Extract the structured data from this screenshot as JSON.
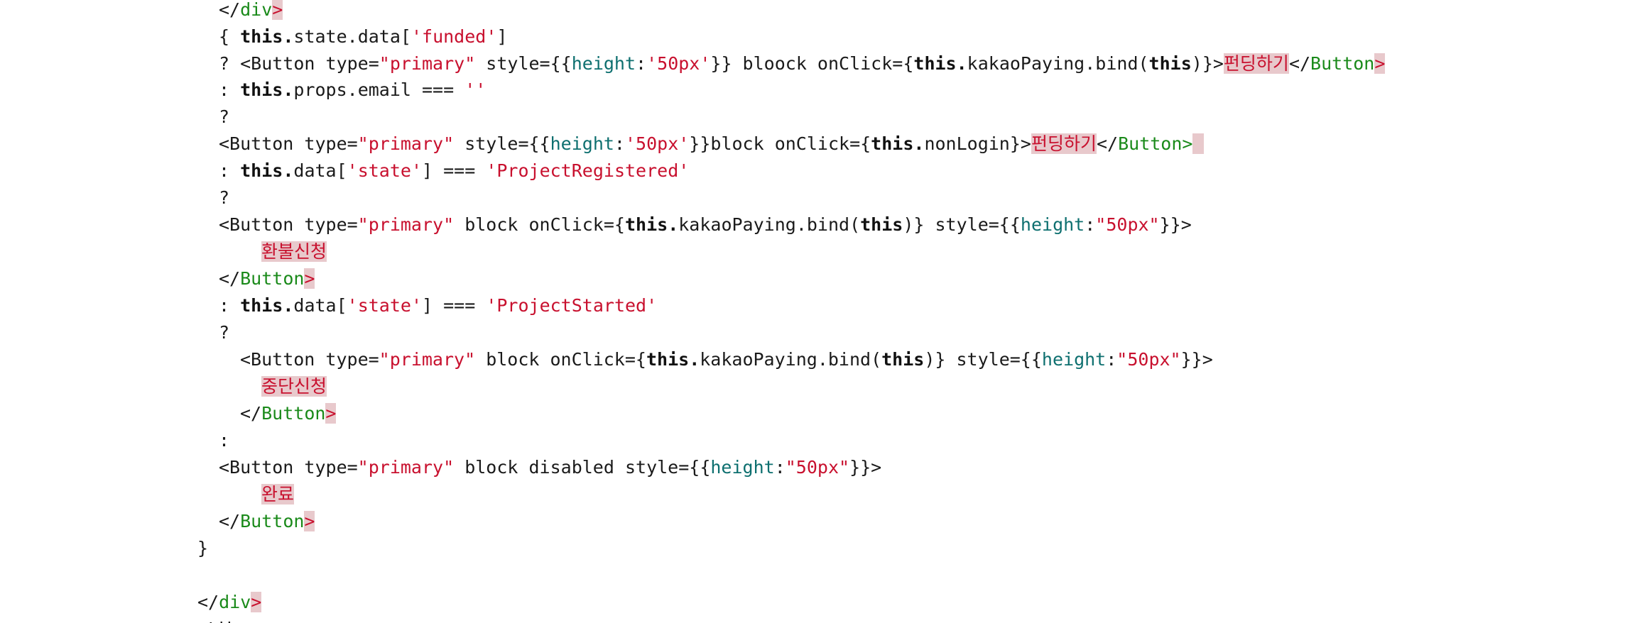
{
  "code_lines": [
    {
      "tokens": [
        [
          "</",
          "punct"
        ],
        [
          "div",
          "tag"
        ],
        [
          ">",
          "gt"
        ]
      ]
    },
    {
      "tokens": [
        [
          "{ ",
          "punct"
        ],
        [
          "this",
          "kw"
        ],
        [
          ".",
          "kw"
        ],
        [
          "state.data[",
          "ident"
        ],
        [
          "'funded'",
          "str"
        ],
        [
          "]",
          "punct"
        ]
      ]
    },
    {
      "tokens": [
        [
          "? <Button type=",
          "ident"
        ],
        [
          "\"primary\"",
          "str"
        ],
        [
          " style={{",
          "ident"
        ],
        [
          "height",
          "prop"
        ],
        [
          ":",
          "punct"
        ],
        [
          "'50px'",
          "str"
        ],
        [
          "}} bloock onClick={",
          "ident"
        ],
        [
          "this",
          "kw"
        ],
        [
          ".",
          "kw"
        ],
        [
          "kakaoPaying.bind(",
          "ident"
        ],
        [
          "this",
          "kw"
        ],
        [
          ")}>",
          "ident"
        ],
        [
          "펀딩하기",
          "text"
        ],
        [
          "</",
          "punct"
        ],
        [
          "Button",
          "tag"
        ],
        [
          ">",
          "gt"
        ]
      ]
    },
    {
      "tokens": [
        [
          ": ",
          "punct"
        ],
        [
          "this",
          "kw"
        ],
        [
          ".",
          "kw"
        ],
        [
          "props.email === ",
          "ident"
        ],
        [
          "''",
          "str"
        ]
      ]
    },
    {
      "tokens": [
        [
          "?",
          "punct"
        ]
      ]
    },
    {
      "tokens": [
        [
          "<Button type=",
          "ident"
        ],
        [
          "\"primary\"",
          "str"
        ],
        [
          " style={{",
          "ident"
        ],
        [
          "height",
          "prop"
        ],
        [
          ":",
          "punct"
        ],
        [
          "'50px'",
          "str"
        ],
        [
          "}}block onClick={",
          "ident"
        ],
        [
          "this",
          "kw"
        ],
        [
          ".",
          "kw"
        ],
        [
          "nonLogin}>",
          "ident"
        ],
        [
          "펀딩하기",
          "text"
        ],
        [
          "</",
          "punct"
        ],
        [
          "Button",
          "tag"
        ],
        [
          ">",
          "tag"
        ],
        [
          " ",
          "hl"
        ]
      ]
    },
    {
      "tokens": [
        [
          ": ",
          "punct"
        ],
        [
          "this",
          "kw"
        ],
        [
          ".",
          "kw"
        ],
        [
          "data[",
          "ident"
        ],
        [
          "'state'",
          "str"
        ],
        [
          "] === ",
          "ident"
        ],
        [
          "'ProjectRegistered'",
          "str"
        ]
      ]
    },
    {
      "tokens": [
        [
          "?",
          "punct"
        ]
      ]
    },
    {
      "tokens": [
        [
          "<Button type=",
          "ident"
        ],
        [
          "\"primary\"",
          "str"
        ],
        [
          " block onClick={",
          "ident"
        ],
        [
          "this",
          "kw"
        ],
        [
          ".",
          "kw"
        ],
        [
          "kakaoPaying.bind(",
          "ident"
        ],
        [
          "this",
          "kw"
        ],
        [
          ")} style={{",
          "ident"
        ],
        [
          "height",
          "prop"
        ],
        [
          ":",
          "punct"
        ],
        [
          "\"50px\"",
          "str"
        ],
        [
          "}}>",
          "ident"
        ]
      ]
    },
    {
      "tokens": [
        [
          "환불신청",
          "text"
        ]
      ]
    },
    {
      "tokens": [
        [
          "</",
          "punct"
        ],
        [
          "Button",
          "tag"
        ],
        [
          ">",
          "gt"
        ]
      ]
    },
    {
      "tokens": [
        [
          ": ",
          "punct"
        ],
        [
          "this",
          "kw"
        ],
        [
          ".",
          "kw"
        ],
        [
          "data[",
          "ident"
        ],
        [
          "'state'",
          "str"
        ],
        [
          "] === ",
          "ident"
        ],
        [
          "'ProjectStarted'",
          "str"
        ]
      ]
    },
    {
      "tokens": [
        [
          "?",
          "punct"
        ]
      ]
    },
    {
      "tokens": [
        [
          "<Button type=",
          "ident"
        ],
        [
          "\"primary\"",
          "str"
        ],
        [
          " block onClick={",
          "ident"
        ],
        [
          "this",
          "kw"
        ],
        [
          ".",
          "kw"
        ],
        [
          "kakaoPaying.bind(",
          "ident"
        ],
        [
          "this",
          "kw"
        ],
        [
          ")} style={{",
          "ident"
        ],
        [
          "height",
          "prop"
        ],
        [
          ":",
          "punct"
        ],
        [
          "\"50px\"",
          "str"
        ],
        [
          "}}>",
          "ident"
        ]
      ]
    },
    {
      "tokens": [
        [
          "중단신청",
          "text"
        ]
      ]
    },
    {
      "tokens": [
        [
          "</",
          "punct"
        ],
        [
          "Button",
          "tag"
        ],
        [
          ">",
          "gt"
        ]
      ]
    },
    {
      "tokens": [
        [
          ":",
          "punct"
        ]
      ]
    },
    {
      "tokens": [
        [
          "<Button type=",
          "ident"
        ],
        [
          "\"primary\"",
          "str"
        ],
        [
          " block disabled style={{",
          "ident"
        ],
        [
          "height",
          "prop"
        ],
        [
          ":",
          "punct"
        ],
        [
          "\"50px\"",
          "str"
        ],
        [
          "}}>",
          "ident"
        ]
      ]
    },
    {
      "tokens": [
        [
          "완료",
          "text"
        ]
      ]
    },
    {
      "tokens": [
        [
          "</",
          "punct"
        ],
        [
          "Button",
          "tag"
        ],
        [
          ">",
          "gt"
        ]
      ]
    },
    {
      "tokens": [
        [
          "}",
          "punct"
        ]
      ]
    },
    {
      "tokens": [
        [
          "</",
          "punct"
        ],
        [
          "div",
          "tag"
        ],
        [
          ">",
          "gt"
        ]
      ]
    },
    {
      "tokens": [
        [
          "</div>",
          "ident"
        ]
      ]
    }
  ]
}
